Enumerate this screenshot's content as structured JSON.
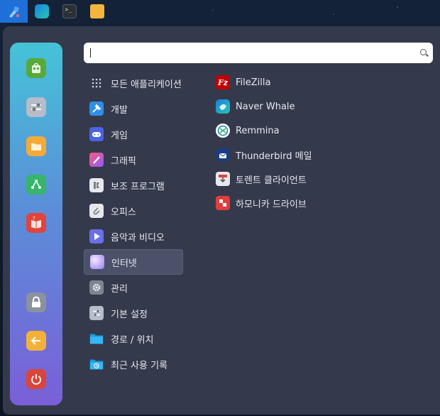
{
  "taskbar": {
    "items": [
      {
        "name": "launcher",
        "icon": "launcher-icon",
        "active": true
      },
      {
        "name": "naver-whale",
        "icon": "whale-icon"
      },
      {
        "name": "terminal",
        "icon": "terminal-icon",
        "glyph": ">_"
      },
      {
        "name": "files",
        "icon": "folder-icon"
      }
    ]
  },
  "sidebar": {
    "buttons": [
      {
        "icon": "app-store-icon",
        "color": "#59a93a"
      },
      {
        "icon": "settings-icon",
        "color": "#b6bcc8"
      },
      {
        "icon": "folder-icon",
        "color": "#f5a93a"
      },
      {
        "icon": "network-icon",
        "color": "#36b56b"
      },
      {
        "icon": "help-book-icon",
        "color": "#e0443c"
      },
      {
        "icon": "lock-icon",
        "color": "#8b929e"
      },
      {
        "icon": "logout-icon",
        "color": "#f4b13a"
      },
      {
        "icon": "power-icon",
        "color": "#d9453b"
      }
    ]
  },
  "search": {
    "value": "",
    "placeholder": ""
  },
  "categories": [
    {
      "label": "모든 애플리케이션",
      "icon": "grid-icon"
    },
    {
      "label": "개발",
      "icon": "development-icon"
    },
    {
      "label": "게임",
      "icon": "gamepad-icon"
    },
    {
      "label": "그래픽",
      "icon": "brush-icon"
    },
    {
      "label": "보조 프로그램",
      "icon": "accessories-icon"
    },
    {
      "label": "오피스",
      "icon": "paperclip-icon"
    },
    {
      "label": "음악과 비디오",
      "icon": "play-icon"
    },
    {
      "label": "인터넷",
      "icon": "internet-icon",
      "selected": true
    },
    {
      "label": "관리",
      "icon": "gear-icon"
    },
    {
      "label": "기본 설정",
      "icon": "preferences-icon"
    },
    {
      "label": "경로 / 위치",
      "icon": "folder-icon"
    },
    {
      "label": "최근 사용 기록",
      "icon": "recent-folder-icon"
    }
  ],
  "apps": [
    {
      "label": "FileZilla",
      "icon": "filezilla-icon"
    },
    {
      "label": "Naver Whale",
      "icon": "whale-icon"
    },
    {
      "label": "Remmina",
      "icon": "remmina-icon"
    },
    {
      "label": "Thunderbird 메일",
      "icon": "thunderbird-icon"
    },
    {
      "label": "토렌트 클라이언트",
      "icon": "torrent-icon"
    },
    {
      "label": "하모니카 드라이브",
      "icon": "drive-icon"
    }
  ],
  "colors": {
    "menu_bg": "#343a4c",
    "sidebar_gradient_top": "#45c3d8",
    "sidebar_gradient_bottom": "#7a5fd8",
    "selected_bg": "#4a5168",
    "taskbar_active": "#1f6fd9"
  }
}
